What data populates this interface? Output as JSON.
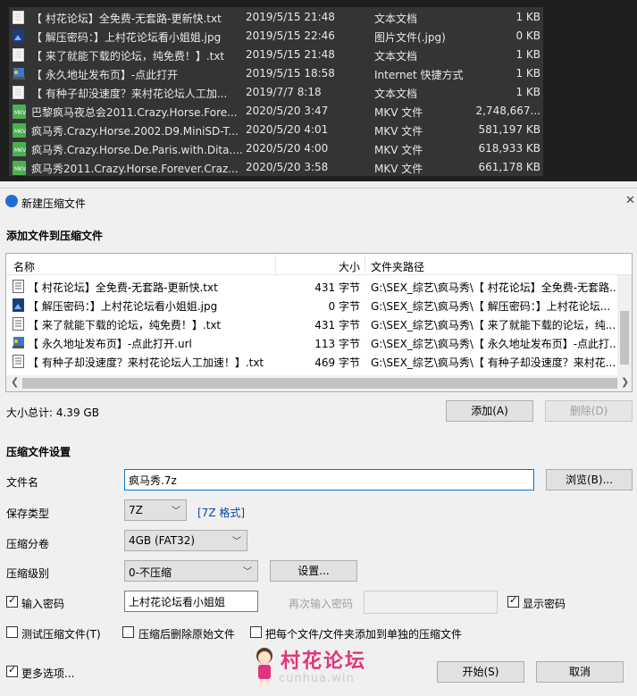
{
  "explorer": {
    "files": [
      {
        "name": "【 村花论坛】全免费-无套路-更新快.txt",
        "date": "2019/5/15 21:48",
        "type": "文本文档",
        "size": "1 KB",
        "icon": "txt-icon"
      },
      {
        "name": "【 解压密码：】上村花论坛看小姐姐.jpg",
        "date": "2019/5/15 22:46",
        "type": "图片文件(.jpg)",
        "size": "0 KB",
        "icon": "jpg-icon"
      },
      {
        "name": "【 来了就能下载的论坛，纯免费！】.txt",
        "date": "2019/5/15 21:48",
        "type": "文本文档",
        "size": "1 KB",
        "icon": "txt-icon"
      },
      {
        "name": "【 永久地址发布页】-点此打开",
        "date": "2019/5/15 18:58",
        "type": "Internet 快捷方式",
        "size": "1 KB",
        "icon": "url-icon"
      },
      {
        "name": "【 有种子却没速度？来村花论坛人工加...",
        "date": "2019/7/7 8:18",
        "type": "文本文档",
        "size": "1 KB",
        "icon": "txt-icon"
      },
      {
        "name": "巴黎疯马夜总会2011.Crazy.Horse.Fore...",
        "date": "2020/5/20 3:47",
        "type": "MKV 文件",
        "size": "2,748,667...",
        "icon": "mkv-icon"
      },
      {
        "name": "疯马秀.Crazy.Horse.2002.D9.MiniSD-T...",
        "date": "2020/5/20 4:01",
        "type": "MKV 文件",
        "size": "581,197 KB",
        "icon": "mkv-icon"
      },
      {
        "name": "疯马秀.Crazy.Horse.De.Paris.with.Dita....",
        "date": "2020/5/20 4:00",
        "type": "MKV 文件",
        "size": "618,933 KB",
        "icon": "mkv-icon"
      },
      {
        "name": "疯马秀2011.Crazy.Horse.Forever.Craz...",
        "date": "2020/5/20 3:58",
        "type": "MKV 文件",
        "size": "661,178 KB",
        "icon": "mkv-icon"
      }
    ]
  },
  "dialog": {
    "title": "新建压缩文件",
    "close": "✕",
    "add_section": "添加文件到压缩文件",
    "list": {
      "headers": {
        "name": "名称",
        "size": "大小",
        "path": "文件夹路径"
      },
      "rows": [
        {
          "name": "【 村花论坛】全免费-无套路-更新快.txt",
          "size": "431 字节",
          "path": "G:\\SEX_综艺\\疯马秀\\【 村花论坛】全免费-无套路...",
          "icon": "txt-icon"
        },
        {
          "name": "【 解压密码：】上村花论坛看小姐姐.jpg",
          "size": "0 字节",
          "path": "G:\\SEX_综艺\\疯马秀\\【 解压密码：】上村花论坛...",
          "icon": "jpg-icon"
        },
        {
          "name": "【 来了就能下载的论坛，纯免费！】.txt",
          "size": "431 字节",
          "path": "G:\\SEX_综艺\\疯马秀\\【 来了就能下载的论坛，纯...",
          "icon": "txt-icon"
        },
        {
          "name": "【 永久地址发布页】-点此打开.url",
          "size": "113 字节",
          "path": "G:\\SEX_综艺\\疯马秀\\【 永久地址发布页】-点此打...",
          "icon": "url-icon"
        },
        {
          "name": "【 有种子却没速度？来村花论坛人工加速！】.txt",
          "size": "469 字节",
          "path": "G:\\SEX_综艺\\疯马秀\\【 有种子却没速度？来村花...",
          "icon": "txt-icon"
        }
      ]
    },
    "total_label": "大小总计: 4.39 GB",
    "add_button": "添加(A)",
    "delete_button": "删除(D)",
    "settings_section": "压缩文件设置",
    "filename_label": "文件名",
    "filename_value": "疯马秀.7z",
    "browse_button": "浏览(B)...",
    "savetype_label": "保存类型",
    "savetype_value": "7Z",
    "format_link": "[7Z 格式]",
    "split_label": "压缩分卷",
    "split_value": "4GB (FAT32)",
    "level_label": "压缩级别",
    "level_value": "0-不压缩",
    "settings_button": "设置...",
    "password_check_label": "输入密码",
    "password_value": "上村花论坛看小姐姐",
    "reenter_label": "再次输入密码",
    "show_password_label": "显示密码",
    "test_label": "测试压缩文件(T)",
    "delete_after_label": "压缩后删除原始文件",
    "separate_label": "把每个文件/文件夹添加到单独的压缩文件",
    "more_options_label": "更多选项...",
    "start_button": "开始(S)",
    "cancel_button": "取消",
    "checks": {
      "password": true,
      "show_password": true,
      "test": false,
      "delete_after": false,
      "separate": false,
      "more_options": true
    }
  },
  "watermark": {
    "text": "村花论坛",
    "url": "cunhua.win"
  }
}
